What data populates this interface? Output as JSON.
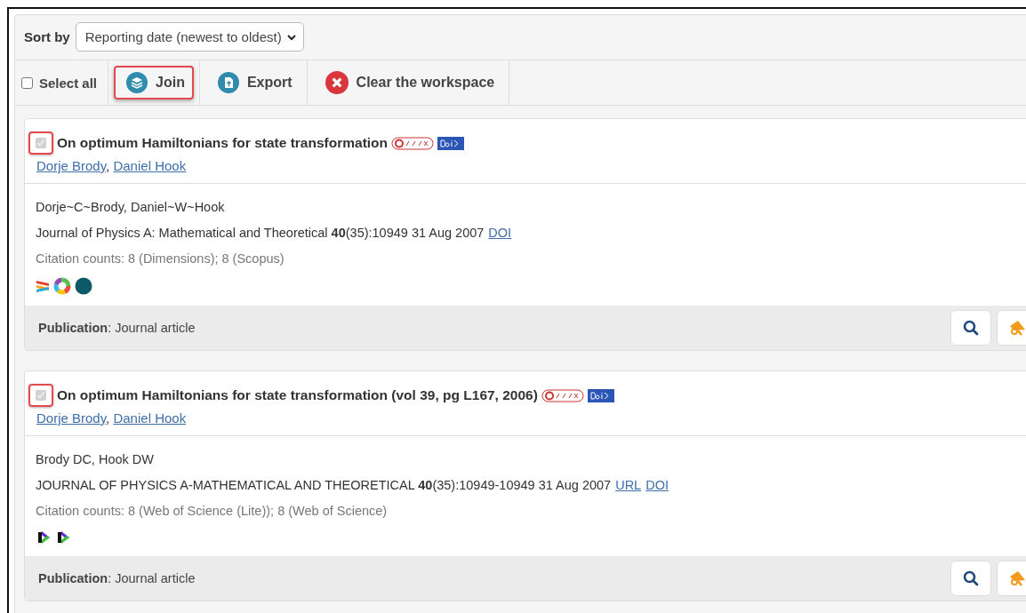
{
  "sort": {
    "label": "Sort by",
    "value": "Reporting date (newest to oldest)"
  },
  "toolbar": {
    "select_all": {
      "label": "Select all",
      "checked": false
    },
    "actions": [
      {
        "kind": "join",
        "label": "Join",
        "highlighted": true
      },
      {
        "kind": "export",
        "label": "Export",
        "highlighted": false
      },
      {
        "kind": "clear",
        "label": "Clear the workspace",
        "highlighted": false
      }
    ]
  },
  "records": [
    {
      "checked": true,
      "highlighted": true,
      "title": "On optimum Hamiltonians for state transformation",
      "authors": [
        "Dorje Brody",
        "Daniel Hook"
      ],
      "author_separator": ",",
      "source_authors": "Dorje~C~Brody, Daniel~W~Hook",
      "journal": "Journal of Physics A: Mathematical and Theoretical **40**(35):10949 31 Aug 2007",
      "links": [
        "DOI"
      ],
      "citations": "Citation counts: 8 (Dimensions); 8 (Scopus)",
      "sources": [
        {
          "kind": "dimensions"
        },
        {
          "kind": "altmetric"
        },
        {
          "kind": "scopus"
        }
      ],
      "type_label": "Publication",
      "type_value": ": Journal article"
    },
    {
      "checked": true,
      "highlighted": true,
      "title": "On optimum Hamiltonians for state transformation (vol 39, pg L167, 2006)",
      "authors": [
        "Dorje Brody",
        "Daniel Hook"
      ],
      "author_separator": ",",
      "source_authors": "Brody DC, Hook DW",
      "journal": "JOURNAL OF PHYSICS A-MATHEMATICAL AND THEORETICAL **40**(35):10949-10949 31 Aug 2007",
      "links": [
        "URL",
        "DOI"
      ],
      "citations": "Citation counts: 8 (Web of Science (Lite)); 8 (Web of Science)",
      "sources": [
        {
          "kind": "clarivate"
        },
        {
          "kind": "clarivate"
        }
      ],
      "type_label": "Publication",
      "type_value": ": Journal article"
    }
  ]
}
